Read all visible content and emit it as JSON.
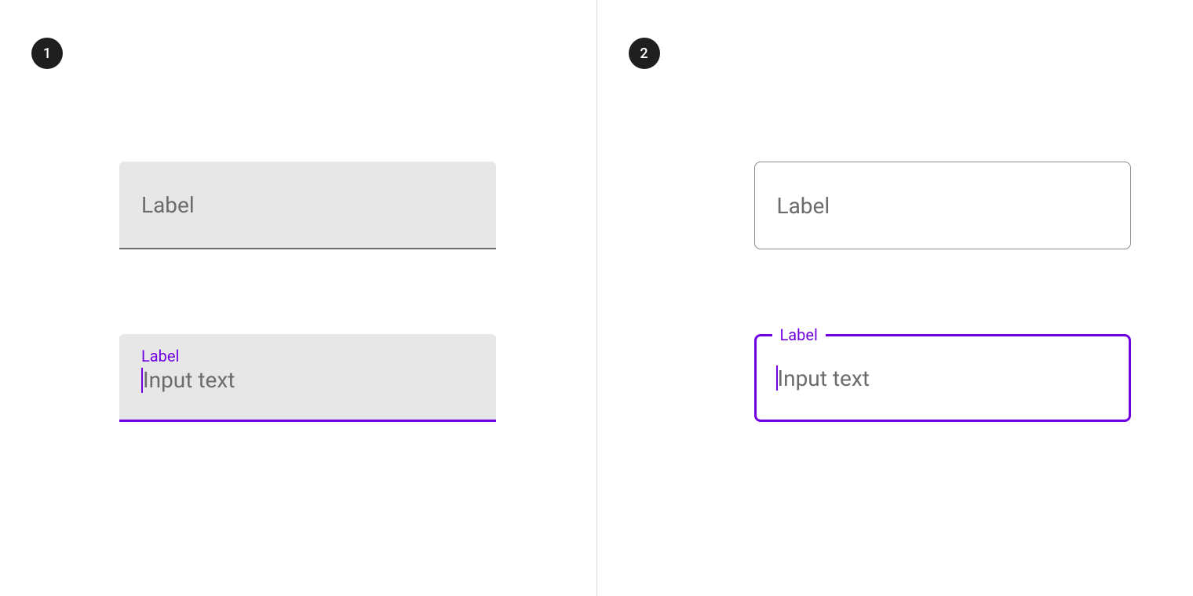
{
  "panels": [
    {
      "badge": "1",
      "filled_inactive": {
        "label": "Label"
      },
      "filled_active": {
        "label": "Label",
        "input": "Input text"
      }
    },
    {
      "badge": "2",
      "outlined_inactive": {
        "label": "Label"
      },
      "outlined_active": {
        "label": "Label",
        "input": "Input text"
      }
    }
  ],
  "colors": {
    "accent": "#7000e0",
    "fill": "#e7e7e7",
    "text_muted": "#6c6c6c",
    "badge_bg": "#1f1f1f"
  }
}
